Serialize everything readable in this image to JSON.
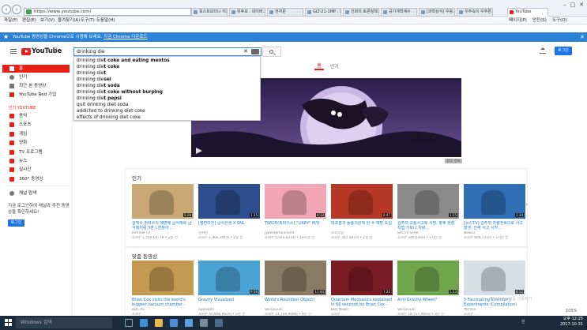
{
  "browser": {
    "url": "https://www.youtube.com/",
    "tabs": [
      "포스트모더니 지금...",
      "위후보 : 네이버...",
      "전자문",
      "GLT-21-1MP : 용...",
      "인화의 토론정책...",
      "공기개혁계수",
      "[과학상식] 우용...",
      "우주속이 우주론...",
      "YouTube"
    ],
    "window_controls": [
      "–",
      "□",
      "✕"
    ],
    "menu": [
      "파일(F)",
      "편집(E)",
      "보기(V)",
      "즐겨찾기(A)",
      "도구(T)",
      "도움말(H)"
    ],
    "tools": [
      "페이지(P)",
      "안전(S)",
      "도구(O)"
    ]
  },
  "notification": {
    "text": "YouTube 동영상을 Chrome으로 시청해 보세요.",
    "link": "지금 Chrome 다운로드",
    "close": "✕"
  },
  "header": {
    "logo_text": "YouTube",
    "logo_kr": "KR",
    "search_value": "drinking die",
    "clear": "✕",
    "login": "로그인"
  },
  "suggestions": [
    "drinking diet coke and eating mentos",
    "drinking diet coke",
    "drinking diet",
    "drinking diesel",
    "drinking diet soda",
    "drinking diet coke without burping",
    "drinking diet pepsi",
    "quit drinking diet soda",
    "addicted to drinking diet coke",
    "effects of drinking diet coke"
  ],
  "sidebar": {
    "items": [
      {
        "label": "홈",
        "icon": "home-icon"
      },
      {
        "label": "인기",
        "icon": "fire-icon"
      },
      {
        "label": "최근 본 동영상",
        "icon": "history-icon"
      },
      {
        "label": "YouTube Red 가입",
        "icon": "youtube-red-icon"
      }
    ],
    "best_title": "인기 YOUTUBE",
    "best": [
      {
        "label": "음악",
        "icon": "music-icon"
      },
      {
        "label": "스포츠",
        "icon": "sports-icon"
      },
      {
        "label": "게임",
        "icon": "gaming-icon"
      },
      {
        "label": "영화",
        "icon": "movies-icon"
      },
      {
        "label": "TV 프로그램",
        "icon": "tv-icon"
      },
      {
        "label": "뉴스",
        "icon": "news-icon"
      },
      {
        "label": "실시간",
        "icon": "live-icon"
      },
      {
        "label": "360° 동영상",
        "icon": "360-icon"
      }
    ],
    "browse": "채널 탐색",
    "message": "지금 로그인하여 채널과 추천 동영상을 확인하세요!",
    "login": "로그인"
  },
  "main_tabs": {
    "home": "홈",
    "trending": "인기"
  },
  "banner_ad": "광고 정보",
  "sections": [
    {
      "title": "인기",
      "videos": [
        {
          "title": "설백수 권력수의 예변해 급식해록 급식체처럼 3편 | 한정아 …",
          "channel": "KimTew TV",
          "meta": "조회수 1,756,03778 • 2일 전",
          "duration": "5:26",
          "color": "#c9a875"
        },
        {
          "title": "[썰변미친] 급식선생 X SNL",
          "channel": "김쉬탄",
          "meta": "조회수 1,966,341회 • 2일 전",
          "duration": "1:35",
          "color": "#2c4d8e"
        },
        {
          "title": "TWICE(트와이스) \"LIKEY\" M/V",
          "channel": "jypentertainment",
          "meta": "조회수 6,926,623회 • 18시간 전",
          "duration": "4:12",
          "color": "#f2a6b5"
        },
        {
          "title": "대조분과 동종의원체 한 수 예방 도입",
          "channel": "소조작업",
          "meta": "조회수 311,487회 • 1일 전",
          "duration": "0:47",
          "color": "#b83826"
        },
        {
          "title": "김주혁 교통사고로 사망, 향후 현장 직접 가보니 차량…",
          "channel": "SPOTV STAR",
          "meta": "조회수 340,659회 • 1시간 전",
          "duration": "1:25",
          "color": "#8a8a8a"
        },
        {
          "title": "[뉴스TV] 김주혁 차량전복으로 사고 발생, 진짜 사고 시각…",
          "channel": "News1",
          "meta": "조회수 804,731회 • 1시간 전",
          "duration": "2:34",
          "color": "#2f6fb5"
        }
      ]
    },
    {
      "title": "맞춤 동영상",
      "videos": [
        {
          "title": "Brian Cox visits the world's biggest vacuum chamber -",
          "channel": "BBC Ab",
          "meta": "조회수 ...",
          "duration": "",
          "color": "#c49a52"
        },
        {
          "title": "Gravity Visualized",
          "channel": "apbiogitn",
          "meta": "조회수 40,806,992회 • 5년 전",
          "duration": "9:58",
          "color": "#4aa3d4"
        },
        {
          "title": "World's Roundest Object!",
          "channel": "Veritasium",
          "meta": "조회수 21,794,909회 • 4년 전",
          "duration": "11:44",
          "color": "#8b7a63"
        },
        {
          "title": "Quantum Mechanics explained in 60 seconds by Brian Cox - BBC",
          "channel": "BBC News",
          "meta": "조회수 ...",
          "duration": "1:22",
          "color": "#7a1c23"
        },
        {
          "title": "Anti-Gravity Wheel?",
          "channel": "Veritasium",
          "meta": "조회수 18,751,460회 • 3년 전",
          "duration": "5:13",
          "color": "#6fa64b"
        },
        {
          "title": "5 Fascinating Chemistry Experiments (Compilation)",
          "channel": "예브와차",
          "meta": "조회수 ...",
          "duration": "8:12",
          "color": "#d8dfe4"
        }
      ]
    }
  ],
  "overlay_text": "Windows 정품 인증하기",
  "zoom": "105%",
  "taskbar": {
    "search": "Windows 검색",
    "time": "오후 12:25",
    "date": "2017-10-31",
    "ime": "한"
  }
}
